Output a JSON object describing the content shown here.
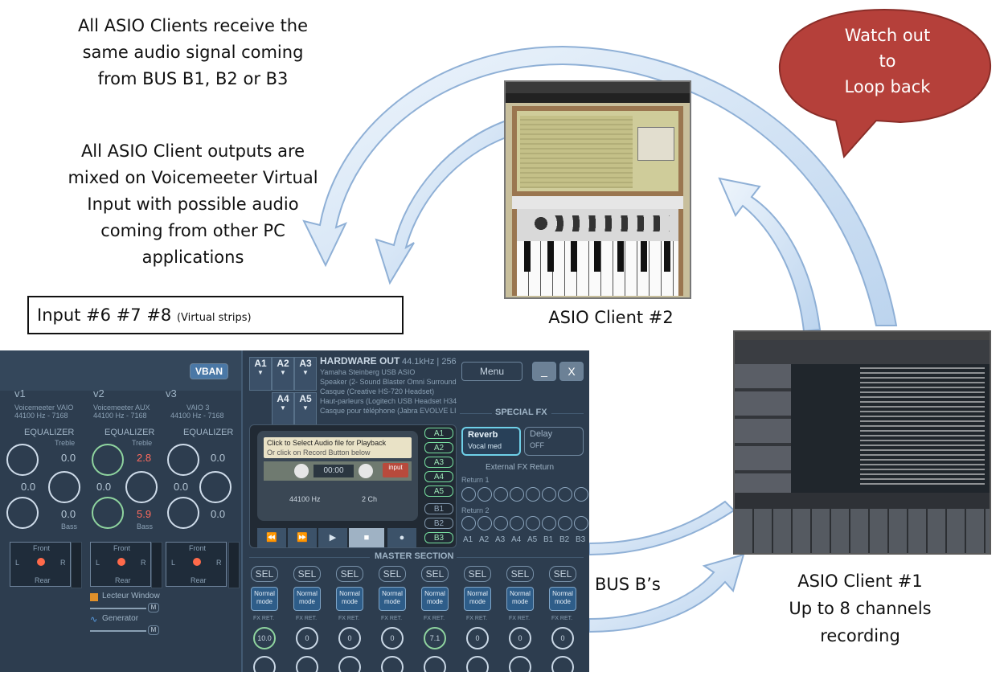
{
  "annotations": {
    "asio_receive": [
      "All ASIO Clients receive the",
      "same audio signal coming",
      "from BUS B1, B2 or B3"
    ],
    "asio_outputs": [
      "All ASIO Client outputs are",
      "mixed on Voicemeeter Virtual",
      "Input with possible audio",
      "coming from other PC",
      "applications"
    ],
    "input_box_main": "Input #6 #7 #8",
    "input_box_small": "(Virtual strips)",
    "asio_client_2": "ASIO Client #2",
    "asio_client_1": [
      "ASIO Client #1",
      "Up to 8 channels",
      "recording"
    ],
    "bus_label": "BUS B’s",
    "warning_bubble": [
      "Watch out",
      "to",
      "Loop back"
    ]
  },
  "colors": {
    "arrow_fill": "#d6e6f7",
    "arrow_stroke": "#8fb0d6",
    "bubble": "#b5403a",
    "panel_bg": "#2d3d4f"
  },
  "voicemeeter": {
    "vban_label": "VBAN",
    "menu_label": "Menu",
    "minimize_label": "_",
    "close_label": "X",
    "strips": [
      {
        "name": "v1",
        "device": "Voicemeeter VAIO",
        "rate": "44100 Hz - 7168",
        "eq_label": "EQUALIZER",
        "treble_label": "Treble",
        "treble": "0.0",
        "mid": "0.0",
        "bass": "0.0",
        "bass_label": "Bass"
      },
      {
        "name": "v2",
        "device": "Voicemeeter AUX",
        "rate": "44100 Hz - 7168",
        "eq_label": "EQUALIZER",
        "treble_label": "Treble",
        "treble": "2.8",
        "mid": "0.0",
        "bass": "5.9",
        "bass_label": "Bass"
      },
      {
        "name": "v3",
        "device": "VAIO 3",
        "rate": "44100 Hz - 7168",
        "eq_label": "EQUALIZER",
        "treble_label": "",
        "treble": "0.0",
        "mid": "0.0",
        "bass": "0.0",
        "bass_label": "Bass"
      }
    ],
    "pan_front": "Front",
    "pan_rear": "Rear",
    "pan_l": "L",
    "pan_r": "R",
    "lecteur_label": "Lecteur Window",
    "generator_label": "Generator",
    "m_label": "M",
    "hardware_out": {
      "title": "HARDWARE OUT",
      "rate": "44.1kHz | 256",
      "buttons": [
        "A1",
        "A2",
        "A3",
        "A4",
        "A5"
      ],
      "devices": [
        "Yamaha Steinberg USB ASIO",
        "Speaker (2- Sound Blaster Omni Surround",
        "Casque (Creative HS-720 Headset)",
        "Haut-parleurs (Logitech USB Headset H34",
        "Casque pour téléphone (Jabra EVOLVE LI"
      ]
    },
    "player": {
      "line1": "Click to Select Audio file for Playback",
      "line2": "Or click on Record Button below",
      "time": "00:00",
      "input_label": "input",
      "rate": "44100 Hz",
      "channels": "2 Ch",
      "controls": [
        "⏪",
        "⏩",
        "▶",
        "■",
        "●"
      ]
    },
    "bus_routing": [
      "A1",
      "A2",
      "A3",
      "A4",
      "A5",
      "B1",
      "B2",
      "B3"
    ],
    "special_fx": {
      "title": "SPECIAL FX",
      "reverb": "Reverb",
      "reverb_sub": "Vocal med",
      "delay": "Delay",
      "delay_sub": "OFF",
      "return_title": "External FX Return",
      "return1": "Return 1",
      "return2": "Return 2",
      "bus_labels": [
        "A1",
        "A2",
        "A3",
        "A4",
        "A5",
        "B1",
        "B2",
        "B3"
      ]
    },
    "master": {
      "title": "MASTER SECTION",
      "sel": "SEL",
      "normal": "Normal mode",
      "fxret": "FX RET.",
      "knob_values": [
        "10.0",
        "0",
        "0",
        "0",
        "7.1",
        "0",
        "0",
        "0"
      ]
    }
  }
}
